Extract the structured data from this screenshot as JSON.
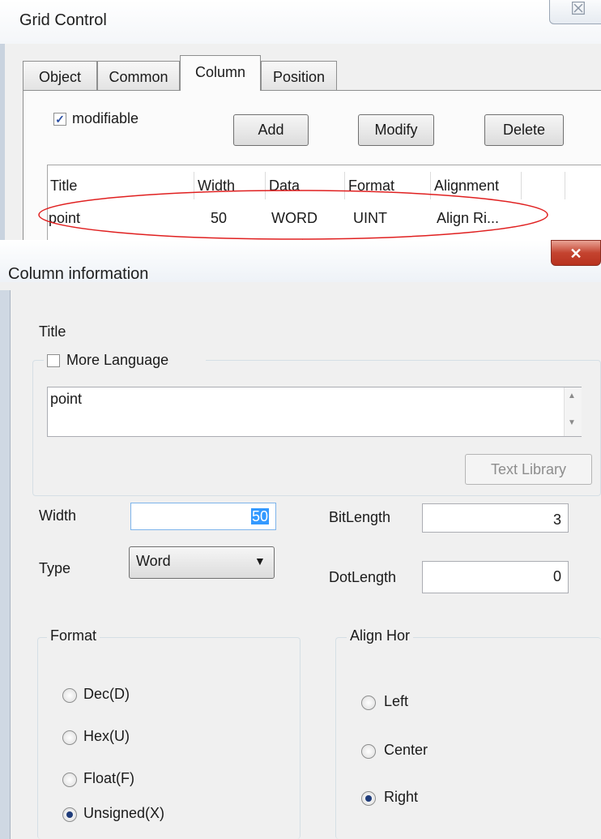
{
  "grid_window": {
    "title": "Grid Control",
    "close_glyph": "☒",
    "tabs": [
      "Object",
      "Common",
      "Column",
      "Position"
    ],
    "active_tab": "Column",
    "modifiable_label": "modifiable",
    "modifiable_checked": true,
    "buttons": {
      "add": "Add",
      "modify": "Modify",
      "delete": "Delete"
    },
    "columns": [
      "Title",
      "Width",
      "Data",
      "Format",
      "Alignment"
    ],
    "rows": [
      {
        "title": "point",
        "width": "50",
        "data": "WORD",
        "format": "UINT",
        "alignment": "Align Ri..."
      }
    ]
  },
  "dialog": {
    "title": "Column information",
    "close_glyph": "✕",
    "title_section_label": "Title",
    "more_language_label": "More Language",
    "title_value": "point",
    "text_library_button": "Text Library",
    "width_label": "Width",
    "width_value": "50",
    "type_label": "Type",
    "type_value": "Word",
    "bitlength_label": "BitLength",
    "bitlength_value": "3",
    "dotlength_label": "DotLength",
    "dotlength_value": "0",
    "format_group_label": "Format",
    "format_options": [
      "Dec(D)",
      "Hex(U)",
      "Float(F)",
      "Unsigned(X)"
    ],
    "format_selected": "Unsigned(X)",
    "align_group_label": "Align Hor",
    "align_options": [
      "Left",
      "Center",
      "Right"
    ],
    "align_selected": "Right"
  },
  "colors": {
    "annotation": "#e02020",
    "close_red": "#c4432f"
  }
}
